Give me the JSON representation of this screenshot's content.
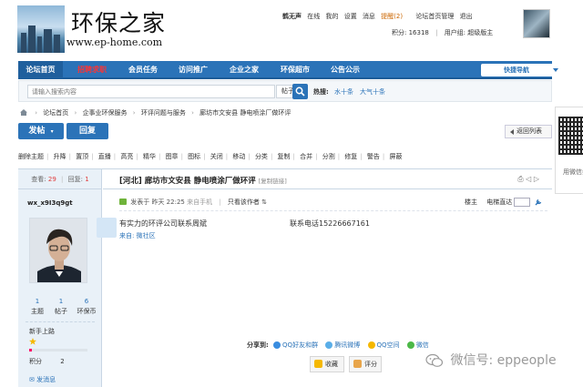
{
  "header": {
    "logo_title": "环保之家",
    "logo_url": "www.ep-home.com",
    "user": {
      "username": "鹤无声",
      "status": "在线",
      "links": [
        "我的",
        "设置",
        "消息"
      ],
      "remind": "提醒(2)",
      "admin_links": [
        "论坛首页管理",
        "退出"
      ],
      "points_label": "积分: 16318",
      "group_label": "用户组: 超级版主"
    }
  },
  "nav": {
    "items": [
      "论坛首页",
      "招聘求职",
      "会员任务",
      "访问推广",
      "企业之家",
      "环保超市",
      "公告公示"
    ],
    "quick_nav": "快捷导航"
  },
  "search": {
    "placeholder": "请输入搜索内容",
    "type": "帖子",
    "hot_label": "热搜:",
    "hot_links": [
      "水十条",
      "大气十条"
    ]
  },
  "breadcrumb": [
    "论坛首页",
    "企事业环保服务",
    "环评问题与服务",
    "廊坊市文安县 静电喷涂厂做环评"
  ],
  "actions": {
    "post": "发帖",
    "reply": "回复",
    "back": "返回列表"
  },
  "tools": [
    "删除主题",
    "升降",
    "置顶",
    "直播",
    "高亮",
    "精华",
    "图章",
    "图标",
    "关闭",
    "移动",
    "分类",
    "复制",
    "合并",
    "分割",
    "修复",
    "警告",
    "屏蔽"
  ],
  "thread": {
    "views_label": "查看:",
    "views": "29",
    "replies_label": "回复:",
    "replies": "1",
    "title": "[河北] 廊坊市文安县 静电喷涂厂做环评",
    "copy_link": "[复制链接]",
    "author": {
      "name": "wx_x9I3q9gt",
      "stats": [
        {
          "n": "1",
          "label": "主题"
        },
        {
          "n": "1",
          "label": "帖子"
        },
        {
          "n": "6",
          "label": "环保币"
        }
      ],
      "group": "新手上路",
      "points_label": "积分",
      "points": "2",
      "message": "发消息",
      "level_fill": 0.04
    },
    "meta": {
      "posted": "发表于 昨天 22:25",
      "client": "来自手机",
      "only_author": "只看该作者",
      "floor": "楼主",
      "goto": "电梯直达"
    },
    "content": "有实力的环评公司联系周斌",
    "phone": "联系电话15226667161",
    "from": "来自: 微社区",
    "share": {
      "label": "分享到:",
      "items": [
        "QQ好友和群",
        "腾讯微博",
        "QQ空间",
        "微信"
      ]
    },
    "buttons": [
      "收藏",
      "评分"
    ]
  },
  "watermark": "微信号: eppeople",
  "qr": {
    "text": "用微信扫 互动"
  },
  "colors": {
    "brand_blue": "#2b73b8",
    "sidebar_bg": "#e9f1f8",
    "hot_red": "#ff3333"
  }
}
